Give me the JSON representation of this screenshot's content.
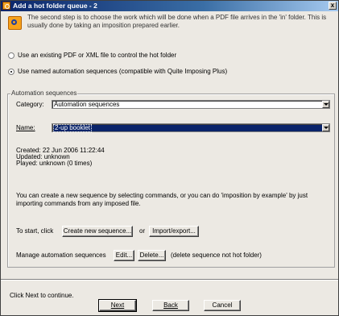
{
  "window": {
    "title": "Add a hot folder queue - 2",
    "close_label": "x"
  },
  "intro": "The second step is to choose the work which will be done when a PDF file arrives in the 'in' folder. This is usually done by taking an imposition prepared earlier.",
  "options": {
    "existing_file": {
      "label": "Use an existing PDF or XML file to control the hot folder",
      "selected": false
    },
    "named_sequences": {
      "label": "Use named automation sequences (compatible with Quite Imposing Plus)",
      "selected": true
    }
  },
  "group": {
    "title": "Automation sequences",
    "category_label": "Category:",
    "category_value": "Automation sequences",
    "name_label": "Name:",
    "name_value": "2-up booklet",
    "created": "Created: 22 Jun 2006 11:22:44",
    "updated": "Updated: unknown",
    "played": "Played: unknown (0 times)",
    "info": "You can create a new sequence by selecting commands, or you can do 'imposition by example' by just importing commands from any imposed file.",
    "start_label": "To start, click",
    "create_button": "Create new sequence...",
    "or_label": "or",
    "import_button": "Import/export...",
    "manage_label": "Manage automation sequences",
    "edit_button": "Edit...",
    "delete_button": "Delete...",
    "delete_note": "(delete sequence not hot folder)"
  },
  "footer": {
    "hint": "Click Next to continue.",
    "next_button": "Next",
    "back_button": "Back",
    "cancel_button": "Cancel"
  }
}
